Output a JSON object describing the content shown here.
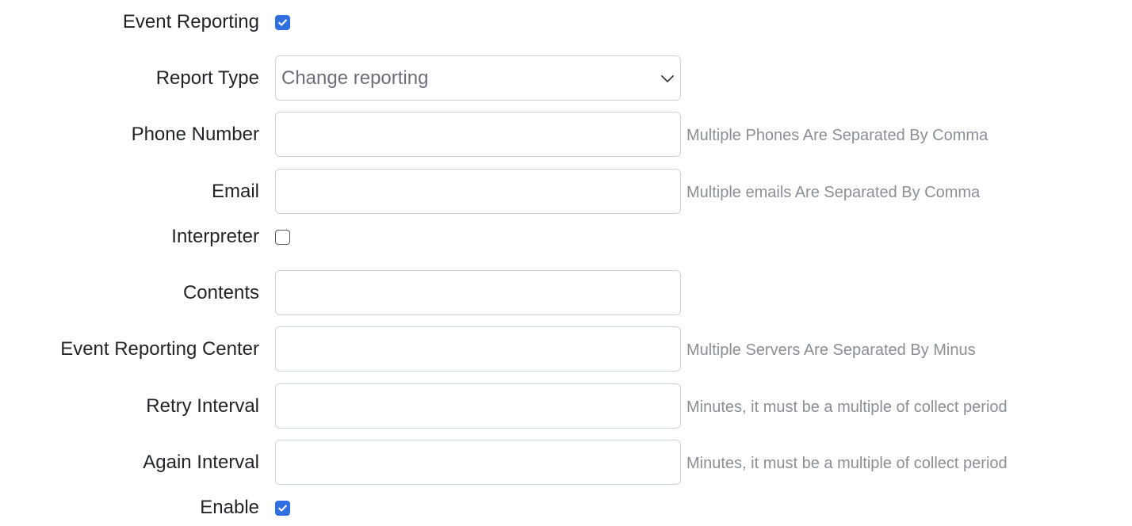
{
  "form": {
    "event_reporting": {
      "label": "Event Reporting",
      "checked": true
    },
    "report_type": {
      "label": "Report Type",
      "selected": "Change reporting"
    },
    "phone_number": {
      "label": "Phone Number",
      "value": "",
      "hint": "Multiple Phones Are Separated By Comma"
    },
    "email": {
      "label": "Email",
      "value": "",
      "hint": "Multiple emails Are Separated By Comma"
    },
    "interpreter": {
      "label": "Interpreter",
      "checked": false
    },
    "contents": {
      "label": "Contents",
      "value": ""
    },
    "event_reporting_center": {
      "label": "Event Reporting Center",
      "value": "",
      "hint": "Multiple Servers Are Separated By Minus"
    },
    "retry_interval": {
      "label": "Retry Interval",
      "value": "",
      "hint": "Minutes, it must be a multiple of collect period"
    },
    "again_interval": {
      "label": "Again Interval",
      "value": "",
      "hint": "Minutes, it must be a multiple of collect period"
    },
    "enable": {
      "label": "Enable",
      "checked": true
    }
  },
  "colors": {
    "checkbox_accent": "#2f6fe0",
    "input_border": "#ced4da",
    "hint_text": "#8a8f96",
    "label_text": "#212529"
  },
  "icons": {
    "check": "check-icon",
    "dropdown": "chevron-down-icon"
  }
}
